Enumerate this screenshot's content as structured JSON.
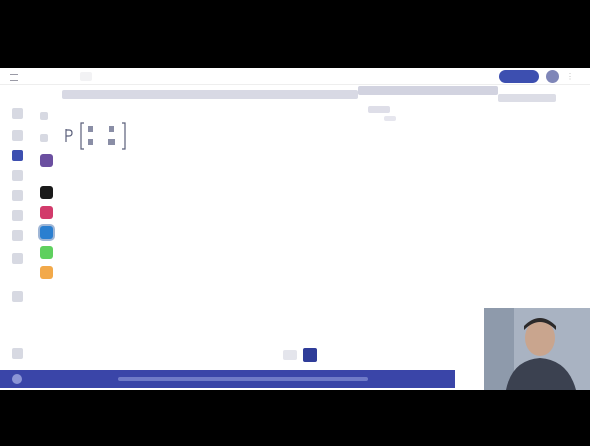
{
  "topbar": {
    "title": "",
    "tab_label": "",
    "share_label": ""
  },
  "board": {
    "line1": "",
    "line2": "",
    "line3": ""
  },
  "banner": {
    "text": ""
  },
  "toolbar": {
    "tools": [
      "pointer-icon",
      "pen-icon",
      "shape-icon",
      "line-icon",
      "text-icon",
      "eraser-icon",
      "image-icon",
      "undo-icon",
      "redo-icon",
      "zoom-icon"
    ],
    "active_tool": "shape-icon"
  },
  "colors": {
    "accent": "#3d4fb0",
    "banner": "#3a45a8",
    "ink": "#1d1d80",
    "swatches": [
      "#6b4fa0",
      "#1a1a1a",
      "#d23b6b",
      "#2a7fd0",
      "#5fd05f",
      "#f2a94a"
    ],
    "selected_swatch": "#2a7fd0"
  }
}
